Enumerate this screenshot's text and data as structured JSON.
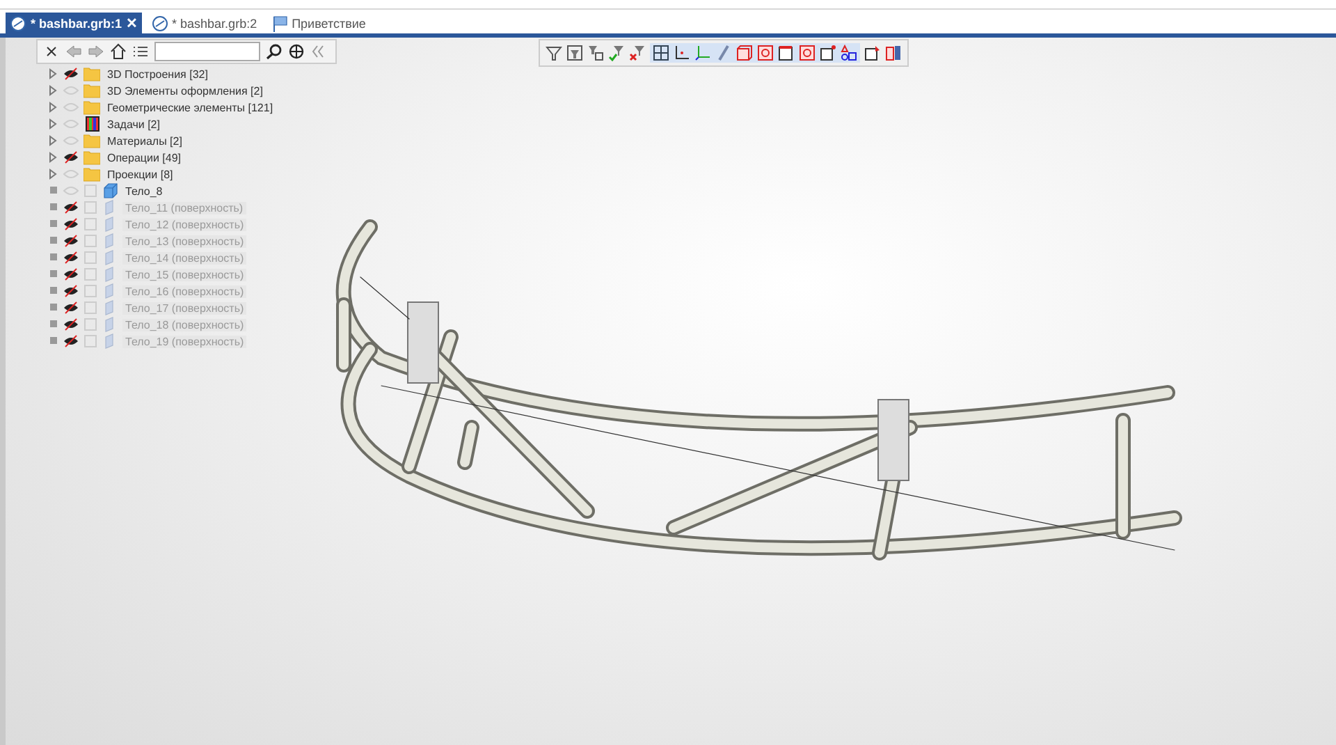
{
  "tabs": [
    {
      "label": "* bashbar.grb:1",
      "selected": true,
      "close": "✕",
      "kind": "doc"
    },
    {
      "label": "* bashbar.grb:2",
      "selected": false,
      "kind": "doc"
    },
    {
      "label": "Приветствие",
      "selected": false,
      "kind": "welcome"
    }
  ],
  "tree": {
    "items": [
      {
        "label": "3D Построения [32]",
        "kind": "folder",
        "shown": true,
        "dimmed": false
      },
      {
        "label": "3D Элементы оформления [2]",
        "kind": "folder",
        "shown": false,
        "dimmed": false
      },
      {
        "label": "Геометрические элементы [121]",
        "kind": "folder",
        "shown": false,
        "dimmed": false
      },
      {
        "label": "Задачи [2]",
        "kind": "tasks",
        "shown": false,
        "dimmed": false
      },
      {
        "label": "Материалы [2]",
        "kind": "folder",
        "shown": false,
        "dimmed": false
      },
      {
        "label": "Операции [49]",
        "kind": "folder",
        "shown": true,
        "dimmed": false
      },
      {
        "label": "Проекции [8]",
        "kind": "folder",
        "shown": false,
        "dimmed": false
      },
      {
        "label": "Тело_8",
        "kind": "body",
        "shown": false,
        "dimmed": false
      },
      {
        "label": "Тело_11 (поверхность)",
        "kind": "surface",
        "shown": true,
        "dimmed": true
      },
      {
        "label": "Тело_12 (поверхность)",
        "kind": "surface",
        "shown": true,
        "dimmed": true
      },
      {
        "label": "Тело_13 (поверхность)",
        "kind": "surface",
        "shown": true,
        "dimmed": true
      },
      {
        "label": "Тело_14 (поверхность)",
        "kind": "surface",
        "shown": true,
        "dimmed": true
      },
      {
        "label": "Тело_15 (поверхность)",
        "kind": "surface",
        "shown": true,
        "dimmed": true
      },
      {
        "label": "Тело_16 (поверхность)",
        "kind": "surface",
        "shown": true,
        "dimmed": true
      },
      {
        "label": "Тело_17 (поверхность)",
        "kind": "surface",
        "shown": true,
        "dimmed": true
      },
      {
        "label": "Тело_18 (поверхность)",
        "kind": "surface",
        "shown": true,
        "dimmed": true
      },
      {
        "label": "Тело_19 (поверхность)",
        "kind": "surface",
        "shown": true,
        "dimmed": true
      }
    ]
  }
}
